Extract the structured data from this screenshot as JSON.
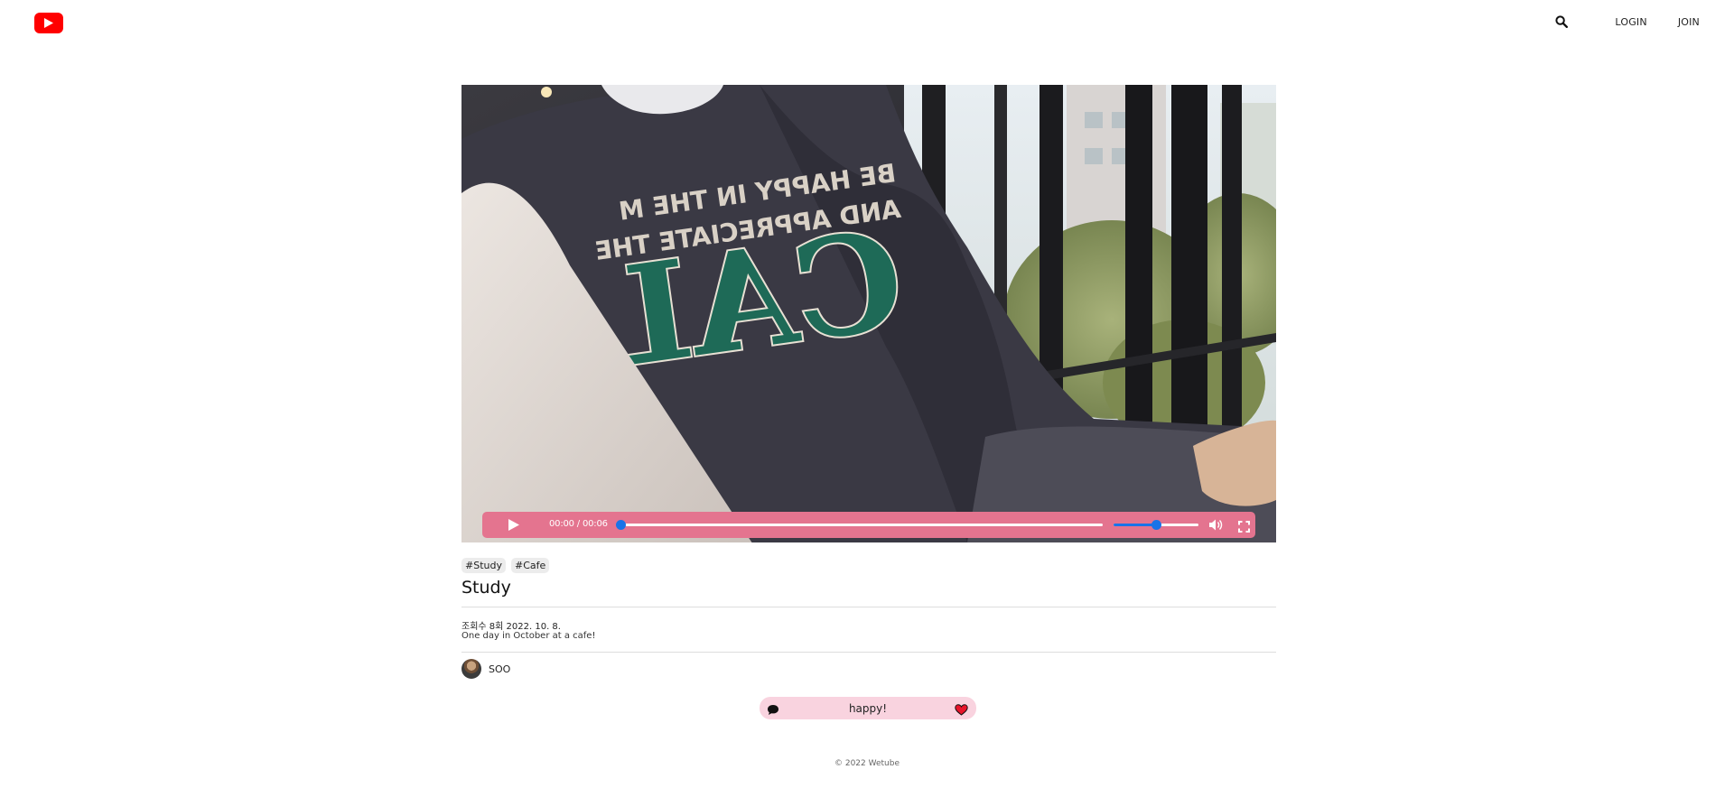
{
  "header": {
    "logo_icon": "youtube-play-icon",
    "search_icon": "search-icon",
    "nav": [
      {
        "label": "LOGIN"
      },
      {
        "label": "JOIN"
      }
    ]
  },
  "player": {
    "time_label": "00:00 / 00:06",
    "progress": 0,
    "volume": 0.5,
    "accent_color": "#e4748f",
    "knob_color": "#1a73e8",
    "icons": [
      "play-icon",
      "volume-icon",
      "fullscreen-icon"
    ]
  },
  "video": {
    "hashtags": [
      "#Study",
      "#Cafe"
    ],
    "title": "Study",
    "views": "조회수 8회",
    "date": "2022. 10. 8.",
    "description": "One day in October at a cafe!",
    "owner": "SOO"
  },
  "comment": {
    "text": "happy!",
    "bubble_color": "#f9d3df",
    "icons": [
      "chat-icon",
      "heart-icon"
    ]
  },
  "footer": {
    "text": "© 2022 Wetube"
  }
}
